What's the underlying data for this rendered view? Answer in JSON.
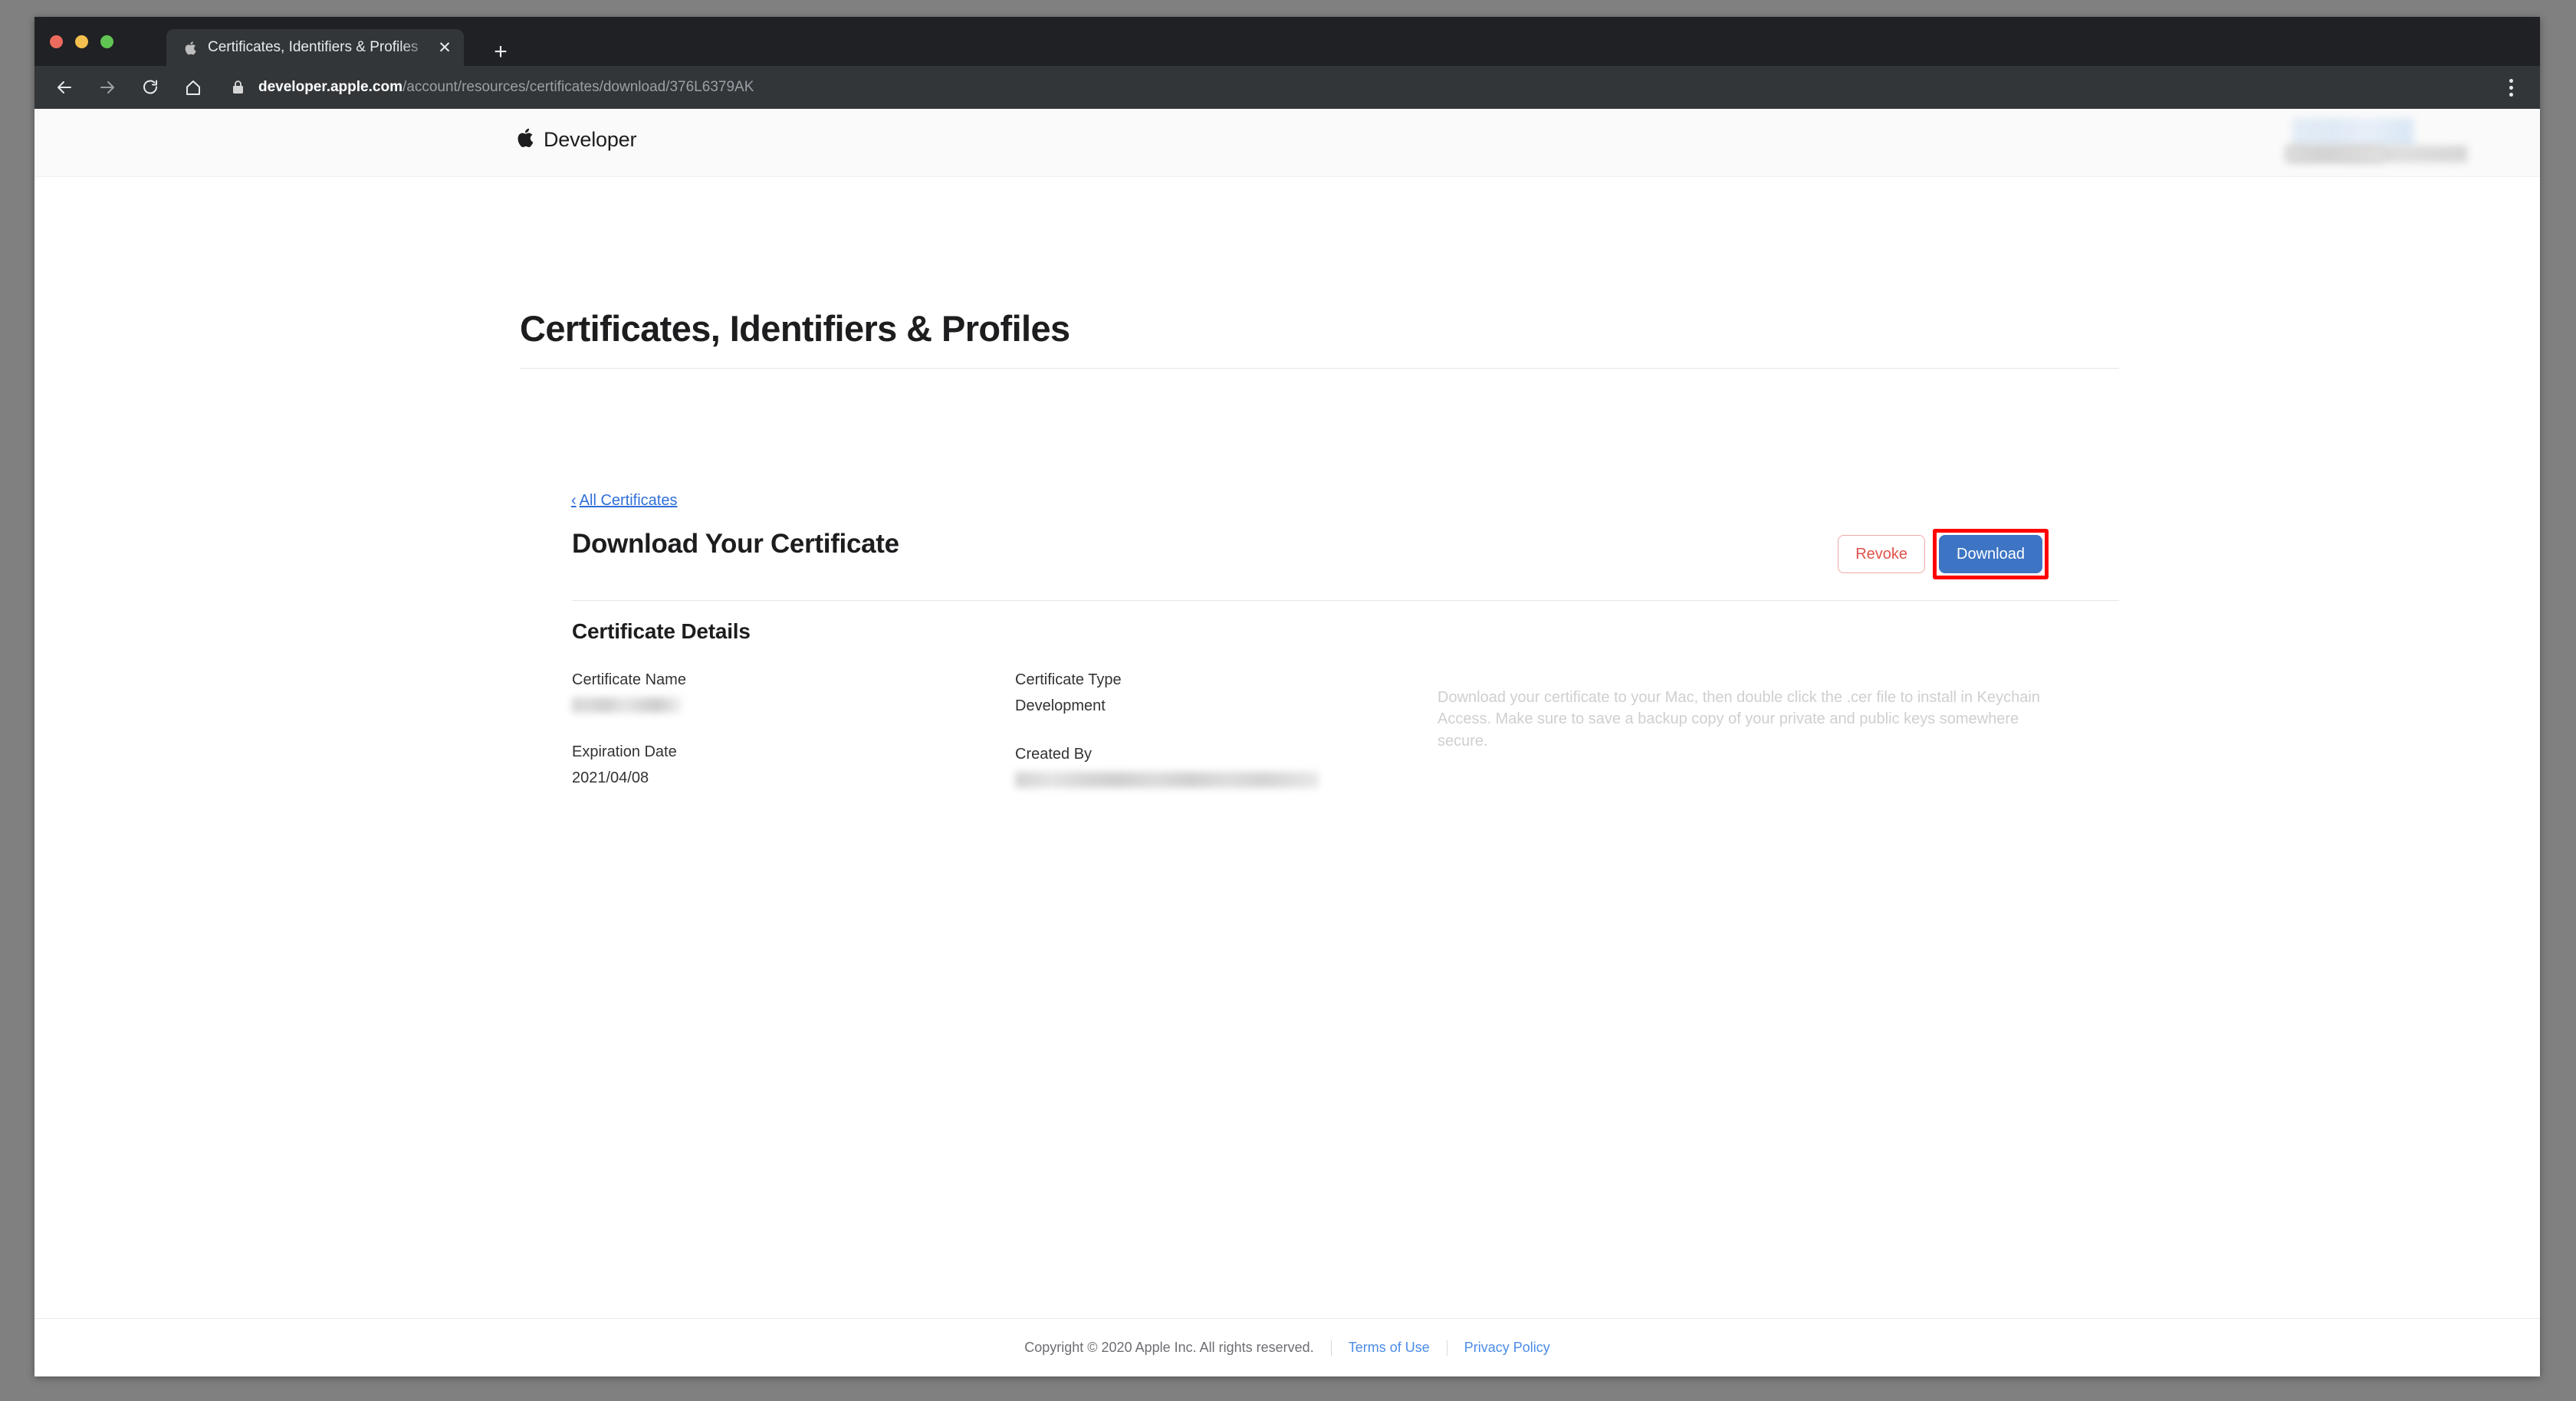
{
  "browser": {
    "traffic_lights": [
      "close",
      "minimize",
      "zoom"
    ],
    "tab": {
      "favicon": "apple-icon",
      "title": "Certificates, Identifiers & Profiles",
      "close_label": "✕"
    },
    "new_tab_label": "+",
    "toolbar": {
      "back_icon": "back-arrow-icon",
      "forward_icon": "forward-arrow-icon",
      "reload_icon": "reload-icon",
      "home_icon": "home-icon",
      "lock_icon": "lock-icon",
      "url_host": "developer.apple.com",
      "url_path": "/account/resources/certificates/download/376L6379AK",
      "menu_icon": "kebab-menu-icon"
    }
  },
  "site_header": {
    "logo_glyph": "apple-logo-icon",
    "logo_text": "Developer",
    "account_redacted": true
  },
  "page": {
    "title": "Certificates, Identifiers & Profiles",
    "breadcrumb": {
      "chevron": "‹",
      "label": "All Certificates"
    },
    "section_heading": "Download Your Certificate",
    "actions": {
      "revoke_label": "Revoke",
      "download_label": "Download",
      "download_highlighted": true,
      "highlight_color": "#ff0000"
    },
    "details": {
      "heading": "Certificate Details",
      "fields": [
        {
          "label": "Certificate Name",
          "value": "",
          "redacted": true
        },
        {
          "label": "Certificate Type",
          "value": "Development",
          "redacted": false
        },
        {
          "label": "Expiration Date",
          "value": "2021/04/08",
          "redacted": false
        },
        {
          "label": "Created By",
          "value": "",
          "redacted": true
        }
      ],
      "help_text": "Download your certificate to your Mac, then double click the .cer file to install in Keychain Access. Make sure to save a backup copy of your private and public keys somewhere secure."
    }
  },
  "footer": {
    "copyright": "Copyright © 2020 Apple Inc. All rights reserved.",
    "terms_label": "Terms of Use",
    "privacy_label": "Privacy Policy"
  },
  "colors": {
    "accent_blue": "#3d74c4",
    "link_blue": "#2f6fd8",
    "danger_red": "#e0534c",
    "highlight_red": "#ff0000",
    "chrome_dark": "#323639"
  }
}
